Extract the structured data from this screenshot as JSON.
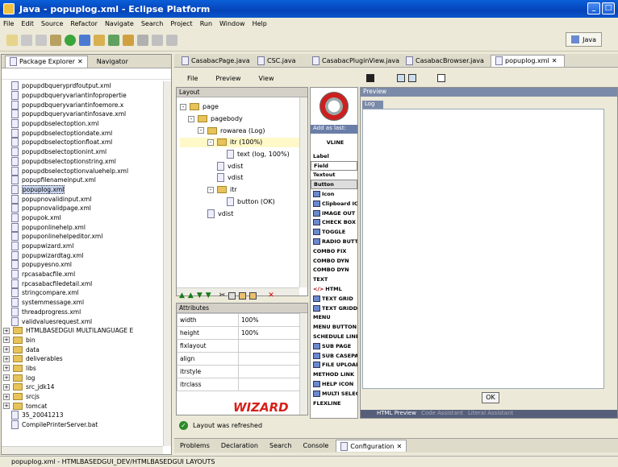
{
  "window": {
    "title": "Java - popuplog.xml - Eclipse Platform"
  },
  "menu": [
    "File",
    "Edit",
    "Source",
    "Refactor",
    "Navigate",
    "Search",
    "Project",
    "Run",
    "Window",
    "Help"
  ],
  "perspective": {
    "label": "Java"
  },
  "explorer": {
    "tabs": [
      "Package Explorer",
      "Navigator"
    ],
    "files": [
      "popupdbqueryprdfoutput.xml",
      "popupdbqueryvariantinfopropertie",
      "popupdbqueryvariantinfoemore.x",
      "popupdbqueryvariantinfosave.xml",
      "popupdbselectoption.xml",
      "popupdbselectoptiondate.xml",
      "popupdbselectoptionfloat.xml",
      "popupdbselectoptionint.xml",
      "popupdbselectoptionstring.xml",
      "popupdbselectoptionvaluehelp.xml",
      "popupfilenameinput.xml",
      "popuplog.xml",
      "popupnovalidinput.xml",
      "popupnovalidpage.xml",
      "popupok.xml",
      "popuponlinehelp.xml",
      "popuponlinehelpeditor.xml",
      "popupwizard.xml",
      "popupwizardtag.xml",
      "popupyesno.xml",
      "rpcasabacfile.xml",
      "rpcasabacfiledetail.xml",
      "stringcompare.xml",
      "systemmessage.xml",
      "threadprogress.xml",
      "validvaluesrequest.xml"
    ],
    "selected": "popuplog.xml",
    "folders": [
      "HTMLBASEDGUI MULTILANGUAGE E",
      "bin",
      "data",
      "deliverables",
      "libs",
      "log",
      "src_jdk14",
      "srcjs",
      "tomcat"
    ],
    "extra": [
      "35_20041213",
      "CompilePrinterServer.bat"
    ]
  },
  "editor": {
    "tabs": [
      "CasabacPage.java",
      "CSC.java",
      "CasabacPluginView.java",
      "CasabacBrowser.java",
      "popuplog.xml"
    ],
    "menu": [
      "File",
      "Preview",
      "View"
    ],
    "layout_header": "Layout",
    "tree": [
      {
        "label": "page",
        "depth": 0
      },
      {
        "label": "pagebody",
        "depth": 1
      },
      {
        "label": "rowarea (Log)",
        "depth": 2
      },
      {
        "label": "itr (100%)",
        "depth": 3
      },
      {
        "label": "text (log, 100%)",
        "depth": 4
      },
      {
        "label": "vdist",
        "depth": 3
      },
      {
        "label": "vdist",
        "depth": 3
      },
      {
        "label": "itr",
        "depth": 3
      },
      {
        "label": "button (OK)",
        "depth": 4
      },
      {
        "label": "vdist",
        "depth": 2
      }
    ],
    "attributes_header": "Attributes",
    "attributes": [
      {
        "name": "width",
        "value": "100%"
      },
      {
        "name": "height",
        "value": "100%"
      },
      {
        "name": "fixlayout",
        "value": ""
      },
      {
        "name": "align",
        "value": ""
      },
      {
        "name": "itrstyle",
        "value": ""
      },
      {
        "name": "itrclass",
        "value": ""
      }
    ],
    "wizard_label": "WIZARD",
    "palette_header": "Add as last:",
    "palette": [
      "VLINE",
      "Label",
      "Field",
      "Textout",
      "Button",
      "Icon",
      "Clipboard ICON",
      "IMAGE OUT",
      "CHECK BOX",
      "TOGGLE",
      "RADIO BUTTON",
      "COMBO FIX",
      "COMBO DYN",
      "COMBO DYN",
      "TEXT",
      "HTML",
      "TEXT GRID",
      "TEXT GRIDDISS",
      "MENU",
      "MENU BUTTON",
      "SCHEDULE LINE",
      "SUB PAGE",
      "SUB CASEPAGE",
      "FILE UPLOAD",
      "METHOD LINK",
      "HELP ICON",
      "MULTI SELECT",
      "FLEXLINE"
    ],
    "preview_header": "Preview",
    "preview_log_label": "Log",
    "preview_ok": "OK",
    "preview_tabs": [
      "HTML Preview",
      "Code Assistant",
      "Literal Assistant"
    ],
    "status_message": "Layout was refreshed"
  },
  "bottom_tabs": [
    "Problems",
    "Declaration",
    "Search",
    "Console",
    "Configuration"
  ],
  "status_bar": "popuplog.xml - HTMLBASEDGUI_DEV/HTMLBASEDGUI LAYOUTS"
}
